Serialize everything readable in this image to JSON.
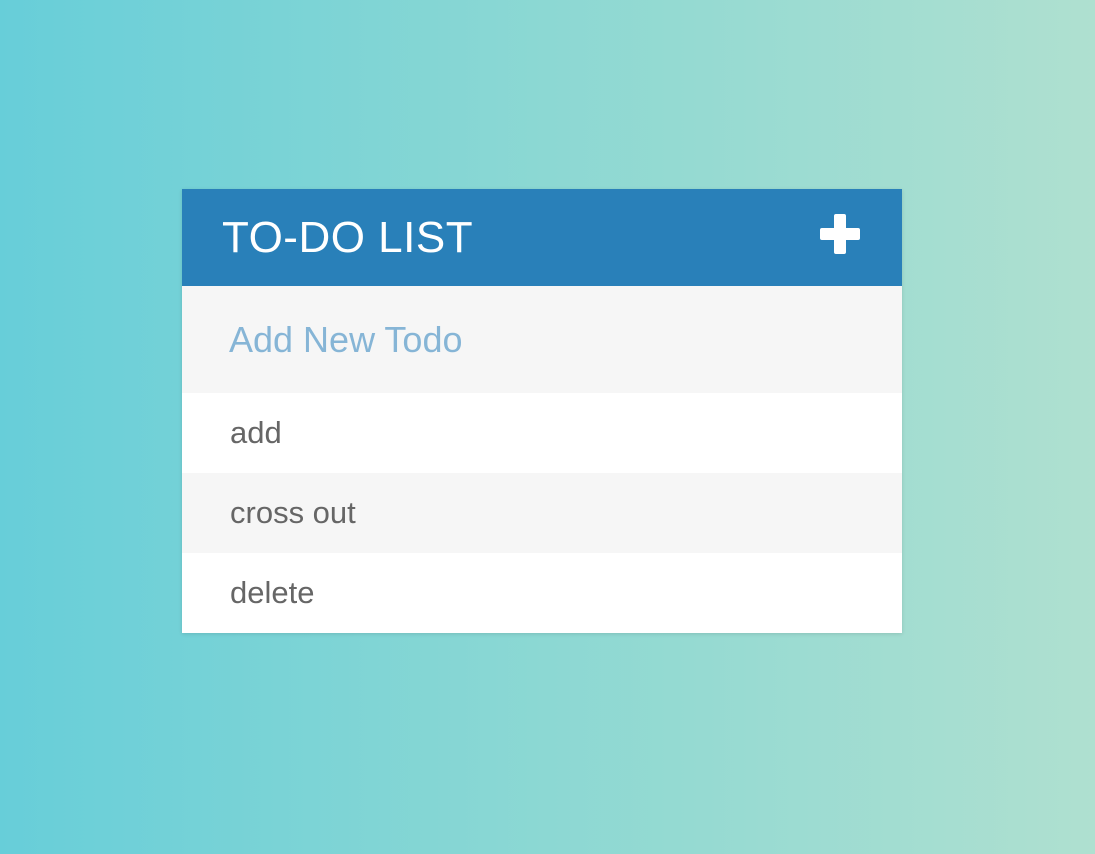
{
  "header": {
    "title": "TO-DO LIST",
    "add_icon": "plus-icon"
  },
  "new_todo": {
    "placeholder": "Add New Todo",
    "value": ""
  },
  "todos": [
    {
      "text": "add"
    },
    {
      "text": "cross out"
    },
    {
      "text": "delete"
    }
  ],
  "colors": {
    "header_bg": "#2980b9",
    "placeholder": "#86b5d6",
    "item_text": "#666666",
    "alt_row_bg": "#f6f6f6",
    "gradient_start": "#67ced9",
    "gradient_end": "#afe0d0"
  }
}
